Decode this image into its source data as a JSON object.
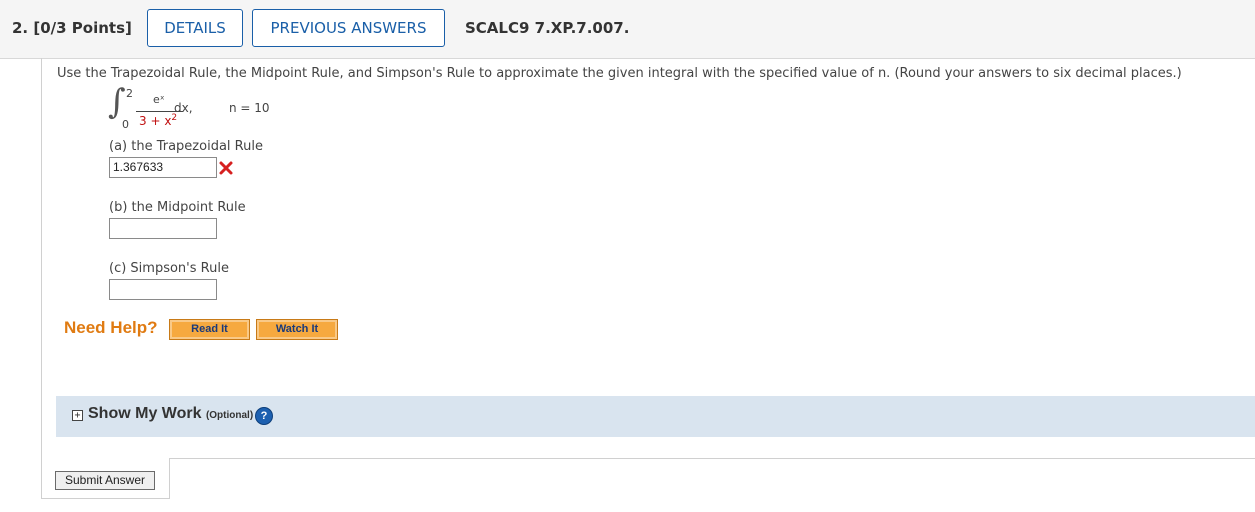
{
  "header": {
    "question_number": "2.",
    "points": "[0/3 Points]",
    "details_label": "DETAILS",
    "previous_answers_label": "PREVIOUS ANSWERS",
    "question_code": "SCALC9 7.XP.7.007."
  },
  "question": {
    "text": "Use the Trapezoidal Rule, the Midpoint Rule, and Simpson's Rule to approximate the given integral with the specified value of n. (Round your answers to six decimal places.)",
    "integral": {
      "upper_limit": "2",
      "lower_limit": "0",
      "numerator": "eˣ",
      "denominator_base": "3 + x",
      "denominator_exp": "2",
      "differential": "dx,",
      "n_value": "n = 10"
    }
  },
  "parts": [
    {
      "label": "(a) the Trapezoidal Rule",
      "value": "1.367633",
      "status": "incorrect"
    },
    {
      "label": "(b) the Midpoint Rule",
      "value": ""
    },
    {
      "label": "(c) Simpson's Rule",
      "value": ""
    }
  ],
  "help": {
    "title": "Need Help?",
    "read_label": "Read It",
    "watch_label": "Watch It"
  },
  "show_work": {
    "title": "Show My Work",
    "optional": "(Optional)",
    "help_glyph": "?"
  },
  "submit_label": "Submit Answer",
  "colors": {
    "accent_blue": "#1a5fa8",
    "help_orange": "#e07b12",
    "incorrect_red": "#d62020",
    "show_work_bg": "#d9e4ef"
  }
}
